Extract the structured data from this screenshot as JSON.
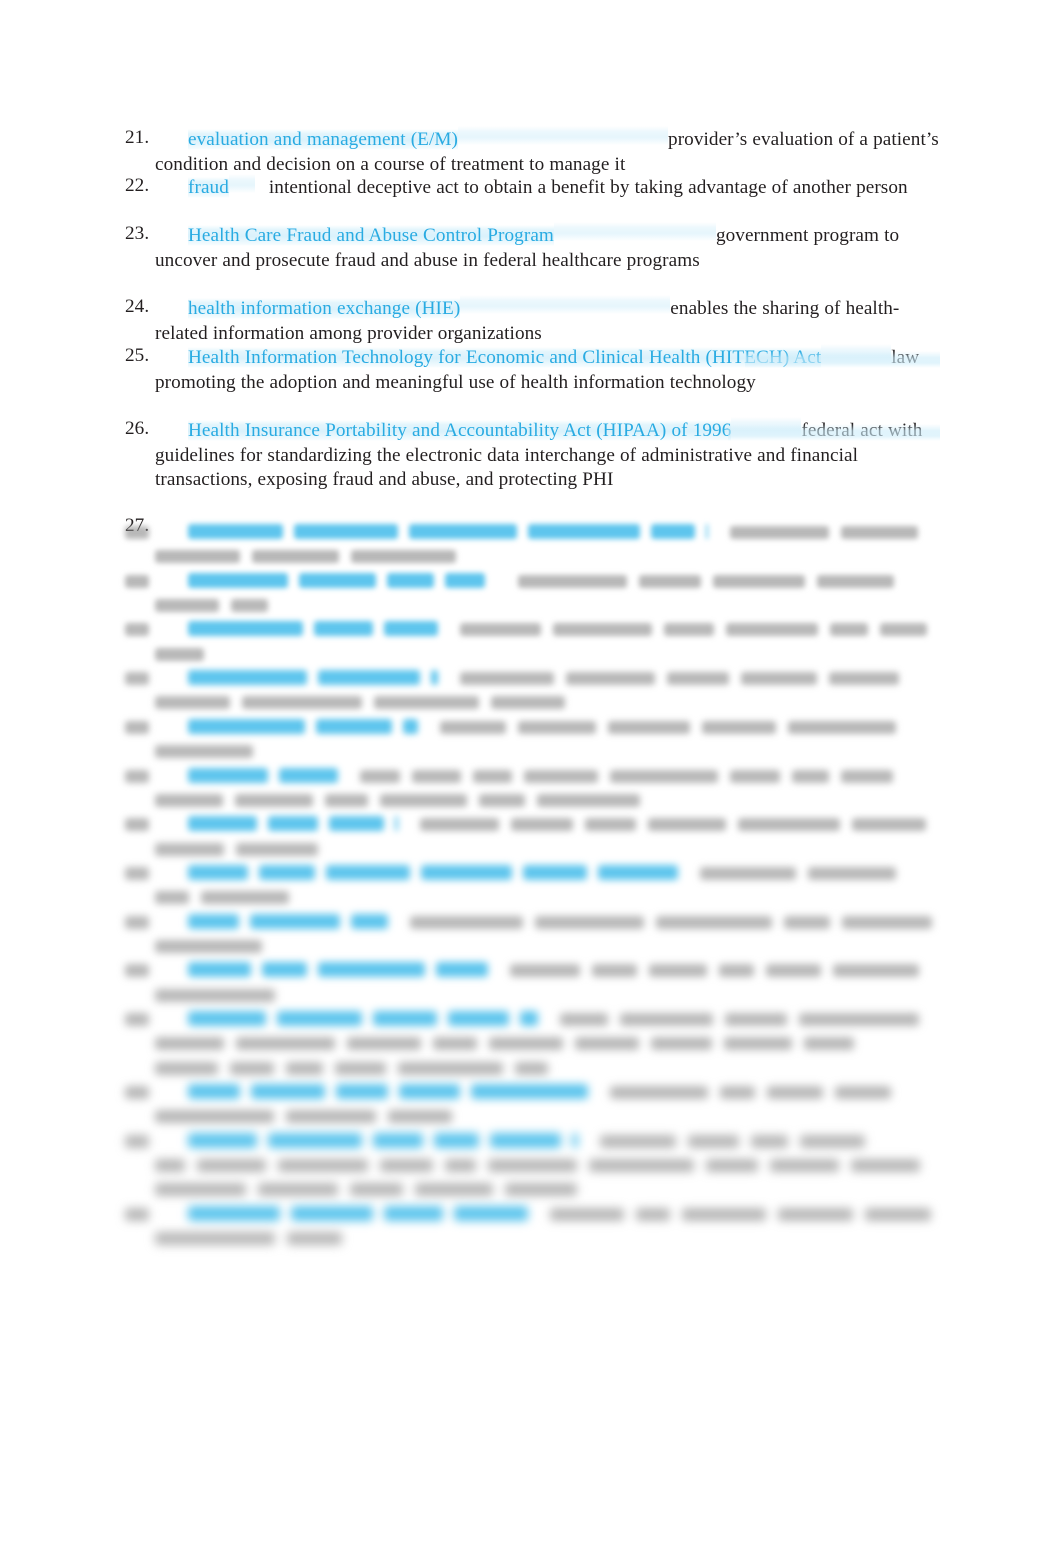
{
  "document": {
    "type": "glossary-definition-list",
    "page_background": "#ffffff",
    "term_color": "#29abe2",
    "body_text_color": "#231f20",
    "highlight_color": "#cdeefa",
    "font_style": "serif",
    "legible_range": "21-27 (number only for 27)",
    "obscured_note": "Content from item 27 onward is blurred and illegible in the source image"
  },
  "items": [
    {
      "number": "21.",
      "term": "evaluation and management (E/M)",
      "definition_line1": "provider’s evaluation of a",
      "definition_rest": "patient’s condition and decision on a course of treatment to manage it",
      "term_highlighted": true,
      "blank_after_term": "xxl"
    },
    {
      "number": "22.",
      "term": "fraud",
      "definition_line1": "intentional deceptive act to obtain a benefit by taking",
      "definition_rest": "advantage of another person",
      "term_highlighted": true,
      "blank_after_term": "sm"
    },
    {
      "number": "23.",
      "term": "Health Care Fraud and Abuse Control Program",
      "definition_line1": "government",
      "definition_rest": "program to uncover and prosecute fraud and abuse in federal healthcare programs",
      "term_highlighted": true,
      "blank_after_term": "xxl"
    },
    {
      "number": "24.",
      "term": "health information exchange (HIE)",
      "definition_line1": "enables the sharing of health-",
      "definition_rest": "related information among provider organizations",
      "term_highlighted": true,
      "blank_after_term": "xxl"
    },
    {
      "number": "25.",
      "term": "Health Information Technology for Economic and Clinical Health (HITECH) Act",
      "definition_line1": "law promoting the adoption and meaningful use of health",
      "definition_rest": "information technology",
      "term_highlighted": true,
      "blank_after_term": "md"
    },
    {
      "number": "26.",
      "term": "Health Insurance Portability and Accountability Act (HIPAA) of 1996",
      "definition_line1": "federal act with guidelines for standardizing the electronic data",
      "definition_rest": "interchange of administrative and financial transactions, exposing fraud and abuse, and protecting PHI",
      "term_highlighted": true,
      "blank_after_term": "md"
    },
    {
      "number": "27.",
      "term": "",
      "definition_line1": "",
      "definition_rest": "",
      "term_highlighted": true,
      "blank_after_term": "none",
      "obscured": true
    }
  ],
  "obscured_items": [
    {
      "index": 0,
      "lines": 2,
      "term_width": 520,
      "illegible": true
    },
    {
      "index": 1,
      "lines": 2,
      "term_width": 300,
      "illegible": true
    },
    {
      "index": 2,
      "lines": 2,
      "term_width": 250,
      "illegible": true
    },
    {
      "index": 3,
      "lines": 2,
      "term_width": 250,
      "illegible": true
    },
    {
      "index": 4,
      "lines": 2,
      "term_width": 230,
      "illegible": true
    },
    {
      "index": 5,
      "lines": 2,
      "term_width": 150,
      "illegible": true
    },
    {
      "index": 6,
      "lines": 2,
      "term_width": 210,
      "illegible": true
    },
    {
      "index": 7,
      "lines": 2,
      "term_width": 490,
      "illegible": true
    },
    {
      "index": 8,
      "lines": 2,
      "term_width": 200,
      "illegible": true
    },
    {
      "index": 9,
      "lines": 2,
      "term_width": 300,
      "illegible": true
    },
    {
      "index": 10,
      "lines": 3,
      "term_width": 350,
      "illegible": true
    },
    {
      "index": 11,
      "lines": 2,
      "term_width": 400,
      "illegible": true
    },
    {
      "index": 12,
      "lines": 3,
      "term_width": 390,
      "illegible": true
    },
    {
      "index": 13,
      "lines": 2,
      "term_width": 340,
      "illegible": true
    }
  ]
}
